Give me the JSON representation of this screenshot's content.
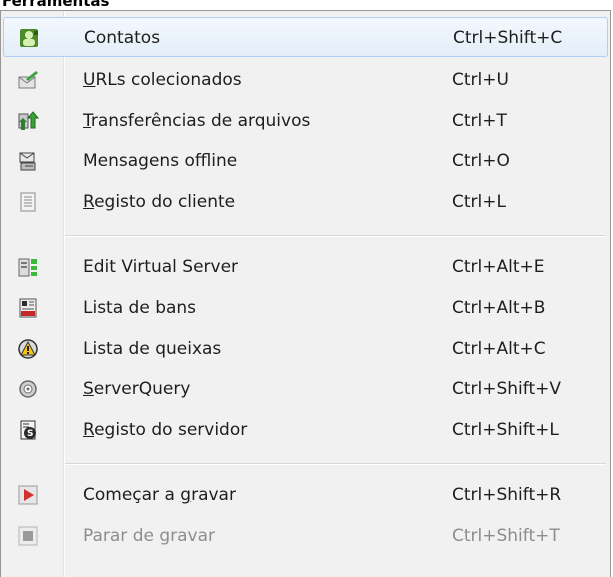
{
  "menu": {
    "title": "Ferramentas",
    "groups": [
      {
        "items": [
          {
            "label": "Contatos",
            "shortcut": "Ctrl+Shift+C",
            "icon": "contacts-icon",
            "highlighted": true
          },
          {
            "label": "URLs colecionados",
            "accel_char": "U",
            "label_rest": "RLs colecionados",
            "shortcut": "Ctrl+U",
            "icon": "collected-urls-icon"
          },
          {
            "label": "Transferências de arquivos",
            "accel_char": "T",
            "label_rest": "ransferências de arquivos",
            "shortcut": "Ctrl+T",
            "icon": "file-transfer-icon"
          },
          {
            "label": "Mensagens offline",
            "shortcut": "Ctrl+O",
            "icon": "offline-messages-icon"
          },
          {
            "label": "Registo do cliente",
            "accel_char": "R",
            "label_rest": "egisto do cliente",
            "shortcut": "Ctrl+L",
            "icon": "client-log-icon"
          }
        ]
      },
      {
        "items": [
          {
            "label": "Edit Virtual Server",
            "shortcut": "Ctrl+Alt+E",
            "icon": "edit-virtual-server-icon"
          },
          {
            "label": "Lista de bans",
            "shortcut": "Ctrl+Alt+B",
            "icon": "ban-list-icon"
          },
          {
            "label": "Lista de queixas",
            "shortcut": "Ctrl+Alt+C",
            "icon": "complaint-list-icon"
          },
          {
            "label": "ServerQuery",
            "accel_char": "S",
            "label_rest": "erverQuery",
            "shortcut": "Ctrl+Shift+V",
            "icon": "server-query-icon"
          },
          {
            "label": "Registo do servidor",
            "accel_char": "R",
            "label_rest": "egisto do servidor",
            "shortcut": "Ctrl+Shift+L",
            "icon": "server-log-icon"
          }
        ]
      },
      {
        "items": [
          {
            "label": "Começar a gravar",
            "label_pre": "Começar a ",
            "accel_char": "g",
            "label_rest": "ravar",
            "shortcut": "Ctrl+Shift+R",
            "icon": "record-start-icon"
          },
          {
            "label": "Parar de gravar",
            "shortcut": "Ctrl+Shift+T",
            "icon": "record-stop-icon",
            "disabled": true
          }
        ]
      }
    ]
  },
  "colors": {
    "menu_bg": "#f1f1f1",
    "highlight_border": "#aecff7",
    "disabled_text": "#8d8d8d"
  }
}
